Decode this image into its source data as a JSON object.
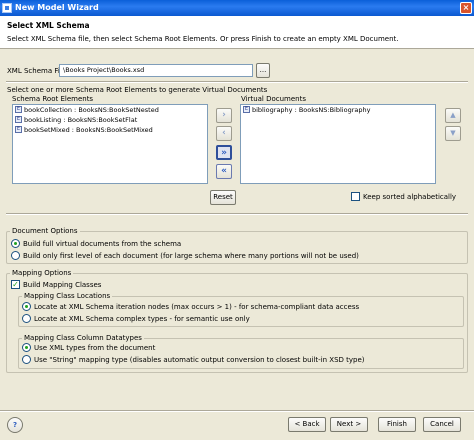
{
  "window": {
    "title": "New Model Wizard",
    "close_glyph": "×"
  },
  "header": {
    "title": "Select XML Schema",
    "description": "Select XML Schema file, then select Schema Root Elements. Or press Finish to create an empty XML Document."
  },
  "schema_file": {
    "label": "XML Schema File:",
    "value": "\\Books Project\\Books.xsd",
    "browse_label": "..."
  },
  "instruction": "Select one or more Schema Root Elements to generate Virtual Documents",
  "root_elements": {
    "label": "Schema Root Elements",
    "items": [
      {
        "icon": "E",
        "text": "bookCollection : BooksNS:BookSetNested"
      },
      {
        "icon": "E",
        "text": "bookListing : BooksNS:BookSetFlat"
      },
      {
        "icon": "E",
        "text": "bookSetMixed : BooksNS:BookSetMixed"
      }
    ]
  },
  "transfer_buttons": {
    "add": "›",
    "remove": "‹",
    "add_all": "»",
    "remove_all": "«"
  },
  "reset_label": "Reset",
  "virtual_documents": {
    "label": "Virtual Documents",
    "items": [
      {
        "icon": "E",
        "text": "bibliography : BooksNS:Bibliography"
      }
    ]
  },
  "order_buttons": {
    "up": "▲",
    "down": "▼"
  },
  "keep_sorted": {
    "label": "Keep sorted alphabetically",
    "checked": false
  },
  "document_options": {
    "title": "Document Options",
    "options": [
      {
        "label": "Build full virtual documents from the schema",
        "selected": true
      },
      {
        "label": "Build only first level of each document (for large schema where many portions will not be used)",
        "selected": false
      }
    ]
  },
  "mapping_options": {
    "title": "Mapping Options",
    "build_mapping_classes": {
      "label": "Build Mapping Classes",
      "checked": true
    },
    "class_locations": {
      "title": "Mapping Class Locations",
      "options": [
        {
          "label": "Locate at XML Schema iteration nodes (max occurs > 1) - for schema-compliant data access",
          "selected": true
        },
        {
          "label": "Locate at XML Schema complex types - for semantic use only",
          "selected": false
        }
      ]
    },
    "column_datatypes": {
      "title": "Mapping Class Column Datatypes",
      "options": [
        {
          "label": "Use XML types from the document",
          "selected": true
        },
        {
          "label": "Use \"String\" mapping type (disables automatic output conversion to closest built-in XSD type)",
          "selected": false
        }
      ]
    }
  },
  "footer": {
    "help": "?",
    "back": "< Back",
    "next": "Next >",
    "finish": "Finish",
    "cancel": "Cancel"
  },
  "colors": {
    "title_bar": "#0a5fd8",
    "dialog_bg": "#ece9d8",
    "check_green": "#21a121"
  }
}
